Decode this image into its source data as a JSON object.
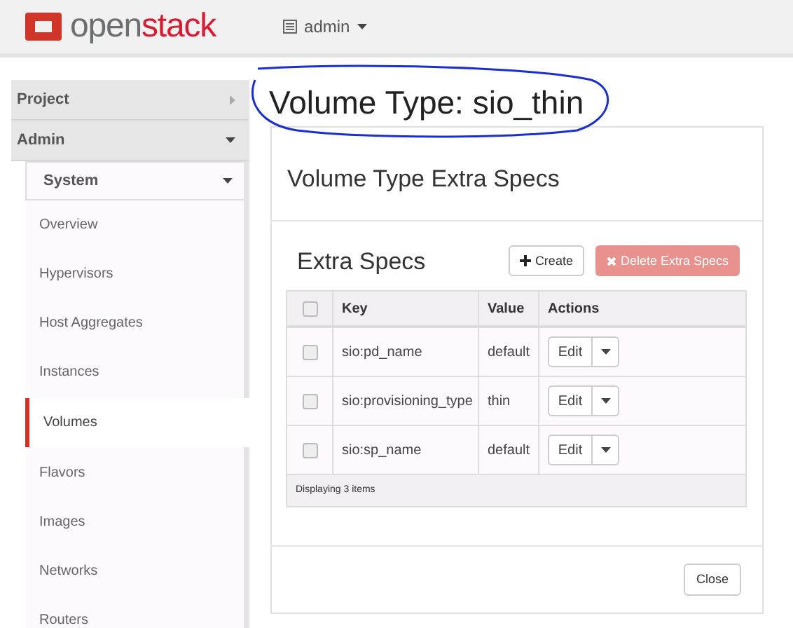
{
  "header": {
    "logo_base": "open",
    "logo_accent": "stack",
    "project_menu": "admin"
  },
  "sidebar": {
    "items": [
      {
        "label": "Project",
        "expanded": false
      },
      {
        "label": "Admin",
        "expanded": true,
        "children": [
          {
            "label": "System",
            "expanded": true,
            "children": [
              {
                "label": "Overview",
                "selected": false
              },
              {
                "label": "Hypervisors",
                "selected": false
              },
              {
                "label": "Host Aggregates",
                "selected": false
              },
              {
                "label": "Instances",
                "selected": false
              },
              {
                "label": "Volumes",
                "selected": true
              },
              {
                "label": "Flavors",
                "selected": false
              },
              {
                "label": "Images",
                "selected": false
              },
              {
                "label": "Networks",
                "selected": false
              },
              {
                "label": "Routers",
                "selected": false
              }
            ]
          }
        ]
      }
    ]
  },
  "page_title": "Volume Type: sio_thin",
  "modal": {
    "title": "Volume Type Extra Specs",
    "section_title": "Extra Specs",
    "create_button": "Create",
    "delete_button": "Delete Extra Specs",
    "delete_disabled": true,
    "table": {
      "select_all_checked": false,
      "columns": [
        "Key",
        "Value",
        "Actions"
      ],
      "rows": [
        {
          "key": "sio:pd_name",
          "value": "default",
          "action": "Edit",
          "checked": false
        },
        {
          "key": "sio:provisioning_type",
          "value": "thin",
          "action": "Edit",
          "checked": false
        },
        {
          "key": "sio:sp_name",
          "value": "default",
          "action": "Edit",
          "checked": false
        }
      ],
      "footer": "Displaying 3 items"
    },
    "close_button": "Close"
  }
}
